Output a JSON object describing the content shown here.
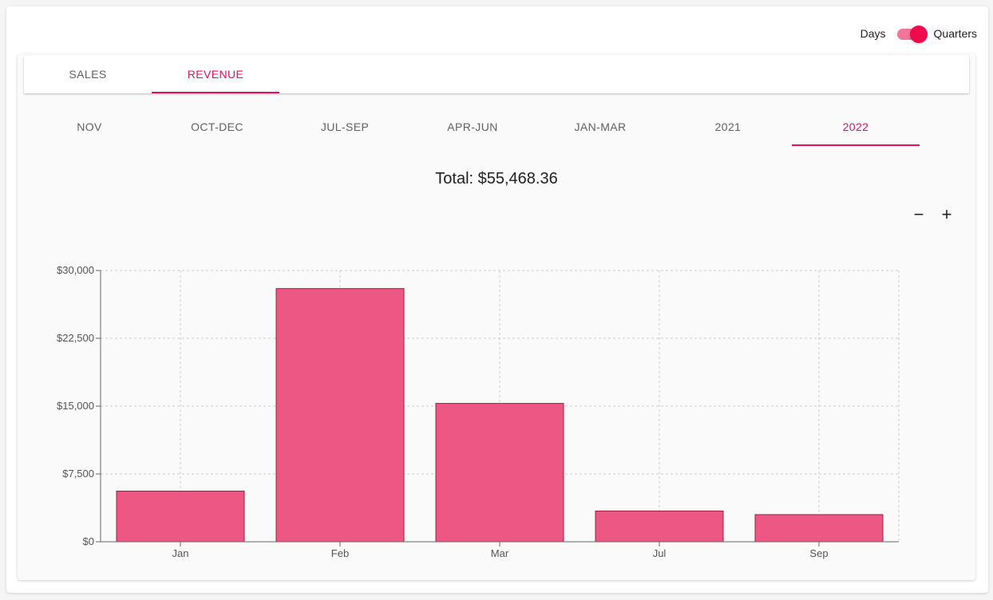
{
  "view_toggle": {
    "left_label": "Days",
    "right_label": "Quarters",
    "checked": true
  },
  "main_tabs": [
    {
      "label": "SALES",
      "active": false
    },
    {
      "label": "REVENUE",
      "active": true
    }
  ],
  "period_tabs": [
    {
      "label": "NOV",
      "active": false
    },
    {
      "label": "OCT-DEC",
      "active": false
    },
    {
      "label": "JUL-SEP",
      "active": false
    },
    {
      "label": "APR-JUN",
      "active": false
    },
    {
      "label": "JAN-MAR",
      "active": false
    },
    {
      "label": "2021",
      "active": false
    },
    {
      "label": "2022",
      "active": true
    }
  ],
  "total_text": "Total: $55,468.36",
  "zoom": {
    "out_symbol": "−",
    "in_symbol": "+"
  },
  "colors": {
    "accent": "#e0115f",
    "bar_fill": "#ec5784",
    "bar_stroke": "#9c1f45",
    "grid": "#cccccc"
  },
  "chart_data": {
    "type": "bar",
    "categories": [
      "Jan",
      "Feb",
      "Mar",
      "Jul",
      "Sep"
    ],
    "values": [
      5600,
      28000,
      15300,
      3400,
      3000
    ],
    "ylim": [
      0,
      30000
    ],
    "yticks": [
      0,
      7500,
      15000,
      22500,
      30000
    ],
    "ytick_labels": [
      "$0",
      "$7,500",
      "$15,000",
      "$22,500",
      "$30,000"
    ],
    "grid": true,
    "title": "",
    "xlabel": "",
    "ylabel": ""
  }
}
